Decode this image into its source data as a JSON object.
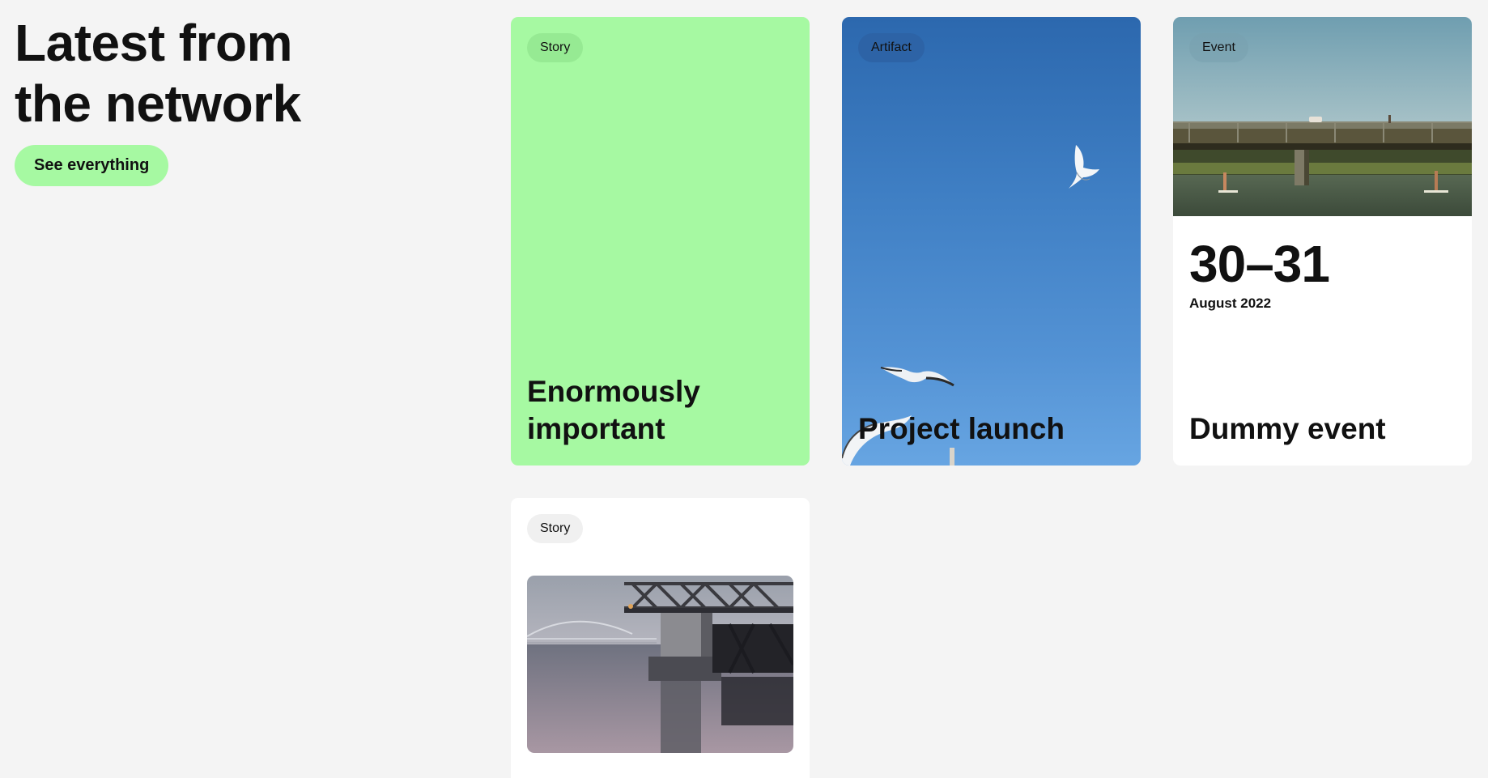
{
  "header": {
    "title_line1": "Latest from",
    "title_line2": "the network",
    "cta_label": "See everything"
  },
  "cards": [
    {
      "tag": "Story",
      "title_line1": "Enormously",
      "title_line2": "important",
      "background": "#a6f9a2"
    },
    {
      "tag": "Artifact",
      "title": "Project launch",
      "background": "#3f7fc4"
    },
    {
      "tag": "Event",
      "date_range": "30–31",
      "date_month": "August 2022",
      "title": "Dummy event"
    },
    {
      "tag": "Story"
    }
  ],
  "colors": {
    "page_bg": "#f4f4f4",
    "accent_green": "#a6f9a2",
    "text": "#111111"
  }
}
